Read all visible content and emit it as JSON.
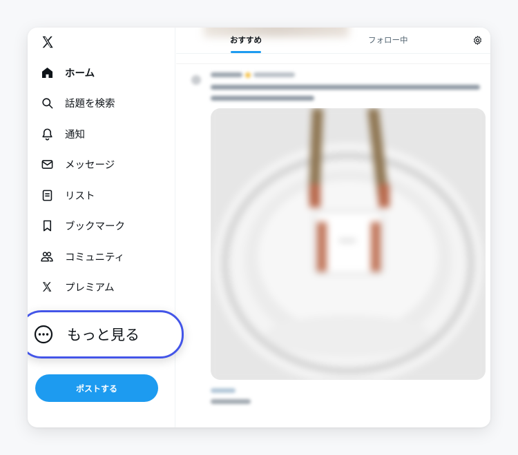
{
  "sidebar": {
    "logo": "x-logo-icon",
    "items": [
      {
        "label": "ホーム",
        "icon": "home-icon",
        "active": true
      },
      {
        "label": "話題を検索",
        "icon": "search-icon"
      },
      {
        "label": "通知",
        "icon": "bell-icon"
      },
      {
        "label": "メッセージ",
        "icon": "mail-icon"
      },
      {
        "label": "リスト",
        "icon": "list-icon"
      },
      {
        "label": "ブックマーク",
        "icon": "bookmark-icon"
      },
      {
        "label": "コミュニティ",
        "icon": "communities-icon"
      },
      {
        "label": "プレミアム",
        "icon": "x-premium-icon"
      }
    ],
    "more": {
      "label": "もっと見る",
      "icon": "more-circle-icon"
    },
    "post_button": "ポストする"
  },
  "main": {
    "tabs": [
      {
        "label": "おすすめ",
        "active": true
      },
      {
        "label": "フォロー中",
        "active": false
      }
    ],
    "settings_icon": "gear-icon"
  },
  "colors": {
    "accent": "#1d9bf0",
    "highlight": "#4355e8",
    "text": "#0f1419"
  }
}
